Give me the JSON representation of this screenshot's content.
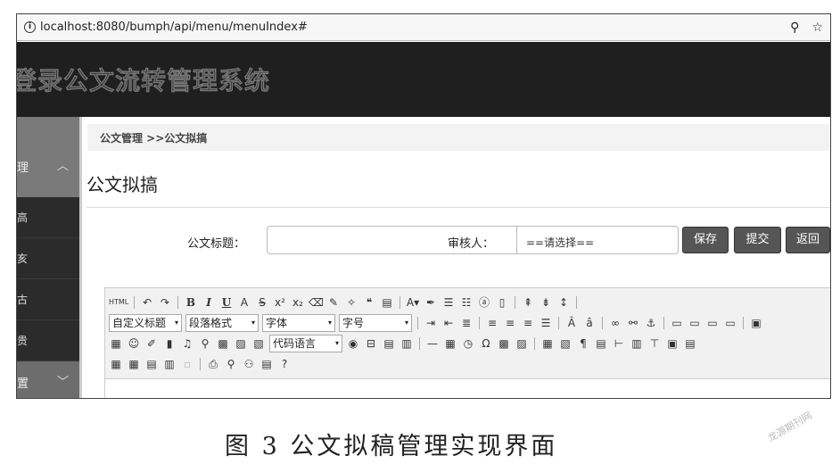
{
  "browser": {
    "url": "localhost:8080/bumph/api/menu/menuIndex#",
    "info_icon": "i",
    "pin_icon": "pin-icon",
    "star_icon": "star-icon"
  },
  "banner": {
    "title": "登录公文流转管理系统"
  },
  "sidebar": {
    "group_top": {
      "label": "理"
    },
    "items": [
      {
        "label": "高"
      },
      {
        "label": "亥"
      },
      {
        "label": "古"
      },
      {
        "label": "贵"
      }
    ],
    "group_bottom": {
      "label": "置"
    }
  },
  "main": {
    "breadcrumb": "公文管理 >>公文拟搞",
    "page_title": "公文拟搞",
    "form": {
      "title_label": "公文标题：",
      "title_value": "",
      "reviewer_label": "审核人：",
      "reviewer_selected": "==请选择=="
    },
    "buttons": {
      "save": "保存",
      "submit": "提交",
      "back": "返回"
    }
  },
  "editor": {
    "html_label": "HTML",
    "combos": {
      "custom_title": "自定义标题",
      "paragraph": "段落格式",
      "font": "字体",
      "size": "字号",
      "code_lang": "代码语言"
    }
  },
  "caption": "图 3   公文拟稿管理实现界面",
  "watermark": "龙源期刊网"
}
